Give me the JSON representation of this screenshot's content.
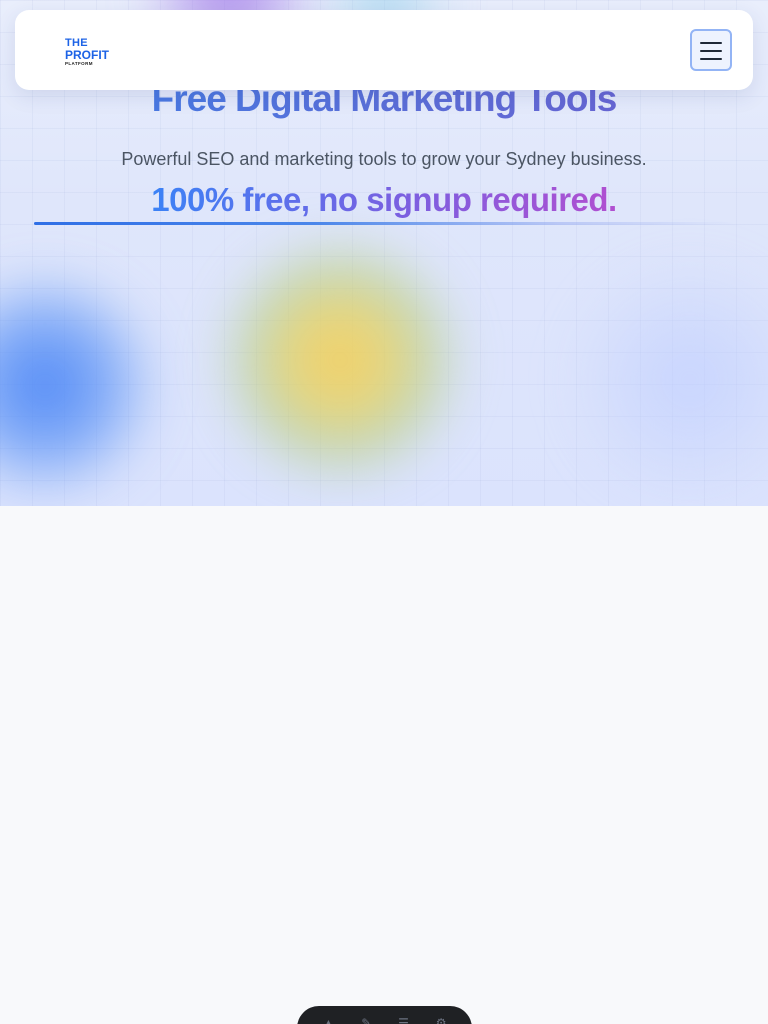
{
  "brand": {
    "logo_line1": "THE",
    "logo_line2": "PROFIT",
    "logo_line3": "PLATFORM"
  },
  "hero": {
    "title": "Free Digital Marketing Tools",
    "subtitle": "Powerful SEO and marketing tools to grow your Sydney business.",
    "tagline": "100% free, no signup required."
  },
  "colors": {
    "accent": "#1d63e6",
    "gradient_start": "#3b82f6",
    "gradient_end": "#b14fd0"
  },
  "icons": {
    "menu": "hamburger-menu-icon"
  }
}
